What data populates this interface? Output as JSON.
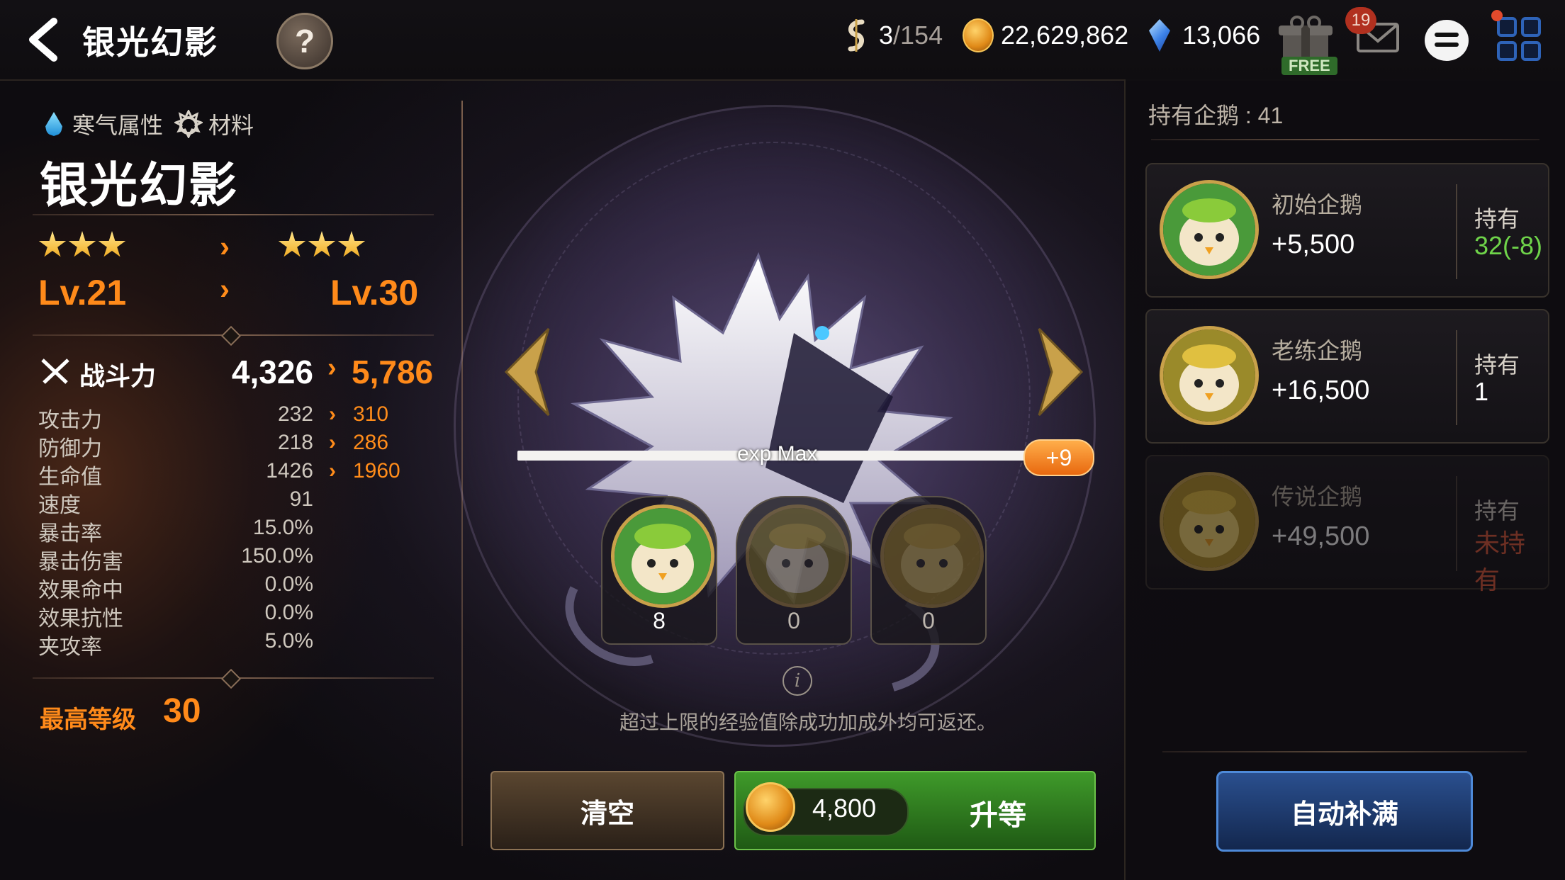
{
  "header": {
    "title": "银光幻影",
    "help_label": "?",
    "stamina": {
      "current": "3",
      "max": "/154"
    },
    "gold": "22,629,862",
    "gems": "13,066",
    "free_label": "FREE",
    "mail_badge": "19"
  },
  "hero": {
    "attribute": "寒气属性",
    "type": "材料",
    "name": "银光幻影",
    "stars_current": 3,
    "stars_next": 3,
    "level_current": "Lv.21",
    "level_next": "Lv.30",
    "combat_power_label": "战斗力",
    "combat_power_current": "4,326",
    "combat_power_next": "5,786",
    "stats": [
      {
        "name": "攻击力",
        "current": "232",
        "next": "310"
      },
      {
        "name": "防御力",
        "current": "218",
        "next": "286"
      },
      {
        "name": "生命值",
        "current": "1426",
        "next": "1960"
      },
      {
        "name": "速度",
        "current": "91",
        "next": ""
      },
      {
        "name": "暴击率",
        "current": "15.0%",
        "next": ""
      },
      {
        "name": "暴击伤害",
        "current": "150.0%",
        "next": ""
      },
      {
        "name": "效果命中",
        "current": "0.0%",
        "next": ""
      },
      {
        "name": "效果抗性",
        "current": "0.0%",
        "next": ""
      },
      {
        "name": "夹攻率",
        "current": "5.0%",
        "next": ""
      }
    ],
    "max_level_label": "最高等级",
    "max_level_value": "30"
  },
  "exp": {
    "label": "exp Max",
    "fill": 1.0,
    "bonus": "+9"
  },
  "material_slots": [
    {
      "count": "8"
    },
    {
      "count": "0"
    },
    {
      "count": "0"
    }
  ],
  "note": "超过上限的经验值除成功加成外均可返还。",
  "buttons": {
    "clear": "清空",
    "upgrade_cost": "4,800",
    "upgrade": "升等",
    "auto_fill": "自动补满"
  },
  "owned": {
    "label": "持有企鹅 : 41",
    "cards": [
      {
        "name": "初始企鹅",
        "exp": "+5,500",
        "hold_label": "持有",
        "hold_value": "32(-8)",
        "hold_color": "#6fd44a"
      },
      {
        "name": "老练企鹅",
        "exp": "+16,500",
        "hold_label": "持有",
        "hold_value": "1",
        "hold_color": "#ffffff"
      },
      {
        "name": "传说企鹅",
        "exp": "+49,500",
        "hold_label": "持有",
        "hold_value": "未持有",
        "hold_color": "#e05a3c"
      }
    ]
  },
  "colors": {
    "accent_orange": "#ff8a1a",
    "upgrade_green": "#3f9a2a",
    "auto_blue": "#2a4f8e"
  }
}
